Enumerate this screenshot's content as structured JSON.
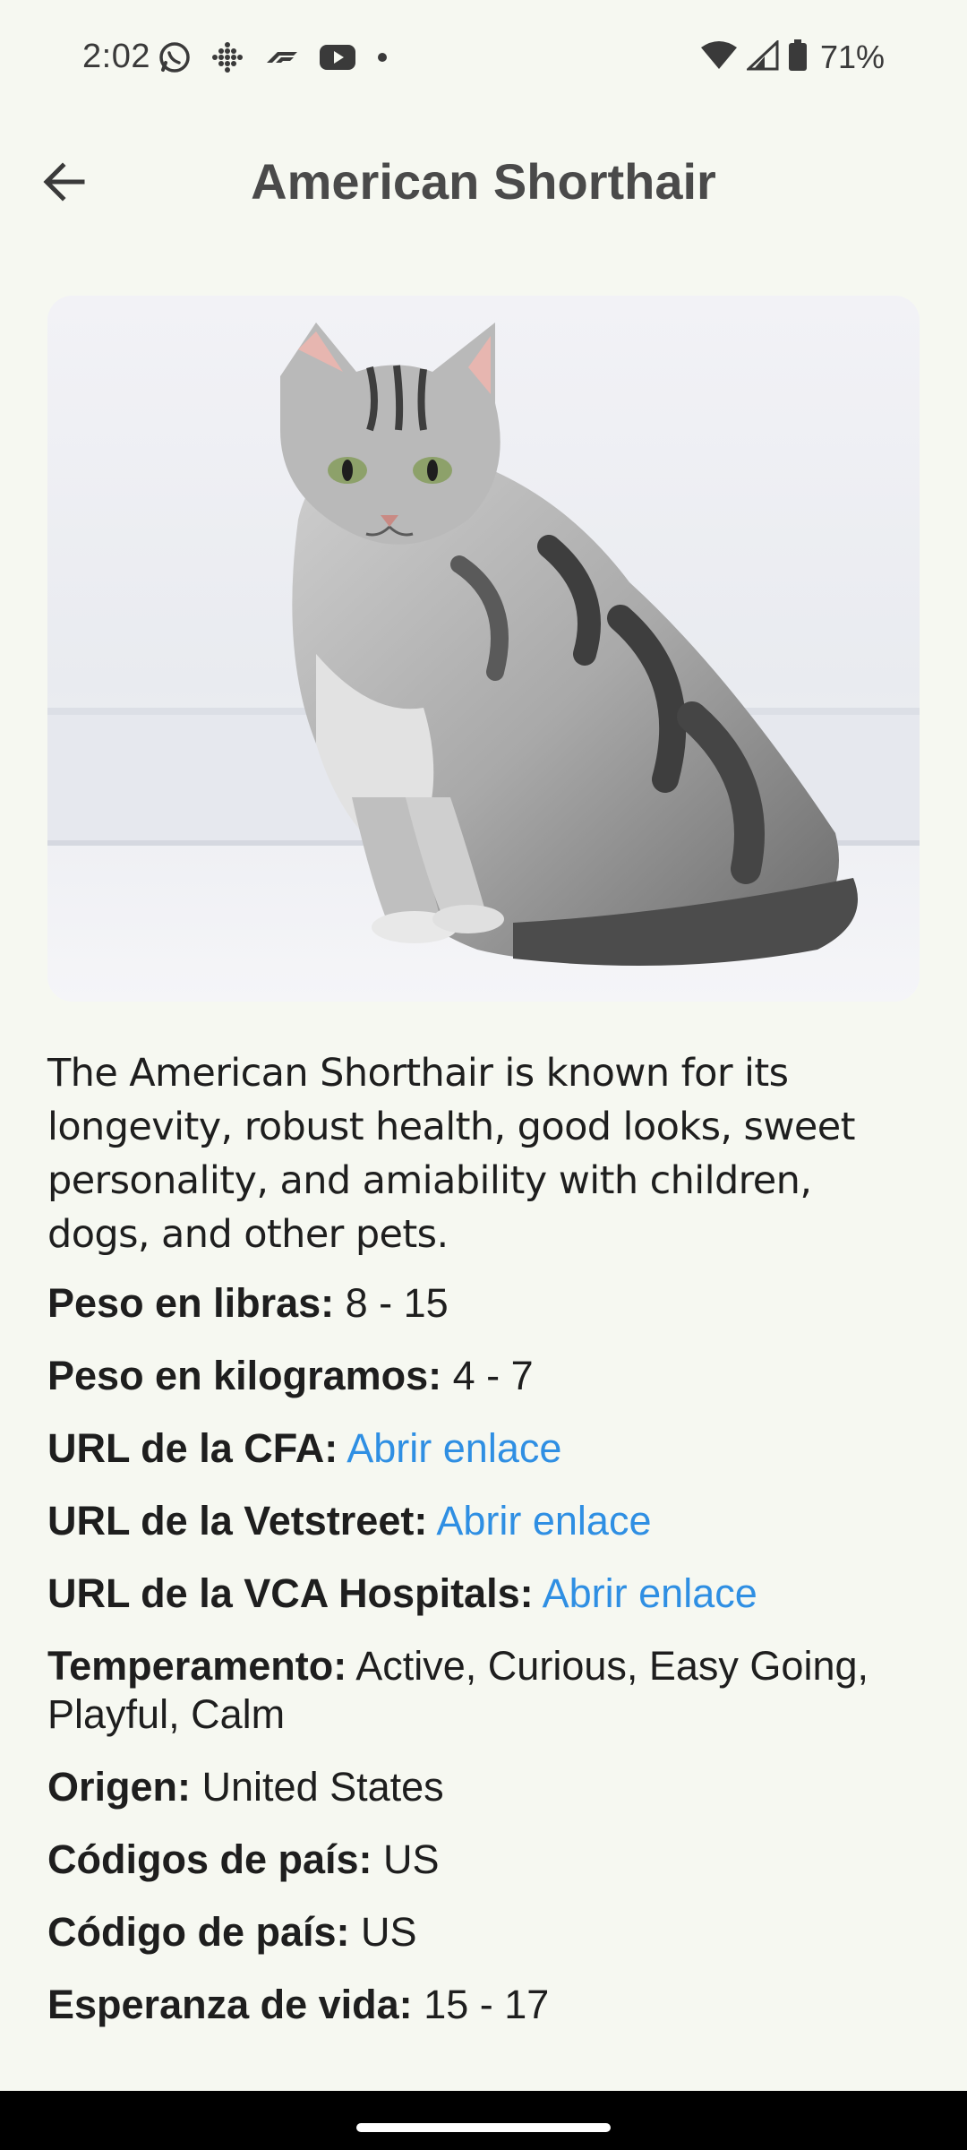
{
  "status_bar": {
    "time": "2:02",
    "battery_percent": "71%",
    "left_icons": [
      "whatsapp-icon",
      "grid-dots-icon",
      "f1-icon",
      "youtube-icon",
      "dot-icon"
    ],
    "right_icons": [
      "wifi-icon",
      "signal-icon",
      "battery-icon"
    ]
  },
  "app_bar": {
    "title": "American Shorthair",
    "back_icon": "arrow-back-icon"
  },
  "breed": {
    "description": "The American Shorthair is known for its longevity, robust health, good looks, sweet personality, and amiability with children, dogs, and other pets.",
    "fields": {
      "weight_lbs": {
        "label": "Peso en libras:",
        "value": "8 - 15"
      },
      "weight_kg": {
        "label": "Peso en kilogramos:",
        "value": "4 - 7"
      },
      "cfa_url": {
        "label": "URL de la CFA:",
        "link": "Abrir enlace"
      },
      "vetstreet_url": {
        "label": "URL de la Vetstreet:",
        "link": "Abrir enlace"
      },
      "vca_url": {
        "label": "URL de la VCA Hospitals:",
        "link": "Abrir enlace"
      },
      "temperament": {
        "label": "Temperamento:",
        "value": "Active, Curious, Easy Going, Playful, Calm"
      },
      "origin": {
        "label": "Origen:",
        "value": "United States"
      },
      "country_codes": {
        "label": "Códigos de país:",
        "value": "US"
      },
      "country_code": {
        "label": "Código de país:",
        "value": "US"
      },
      "life_span": {
        "label": "Esperanza de vida:",
        "value": "15 - 17"
      }
    }
  },
  "colors": {
    "background": "#f6f8f1",
    "link": "#2f8fe3",
    "title": "#4a4a4a"
  }
}
